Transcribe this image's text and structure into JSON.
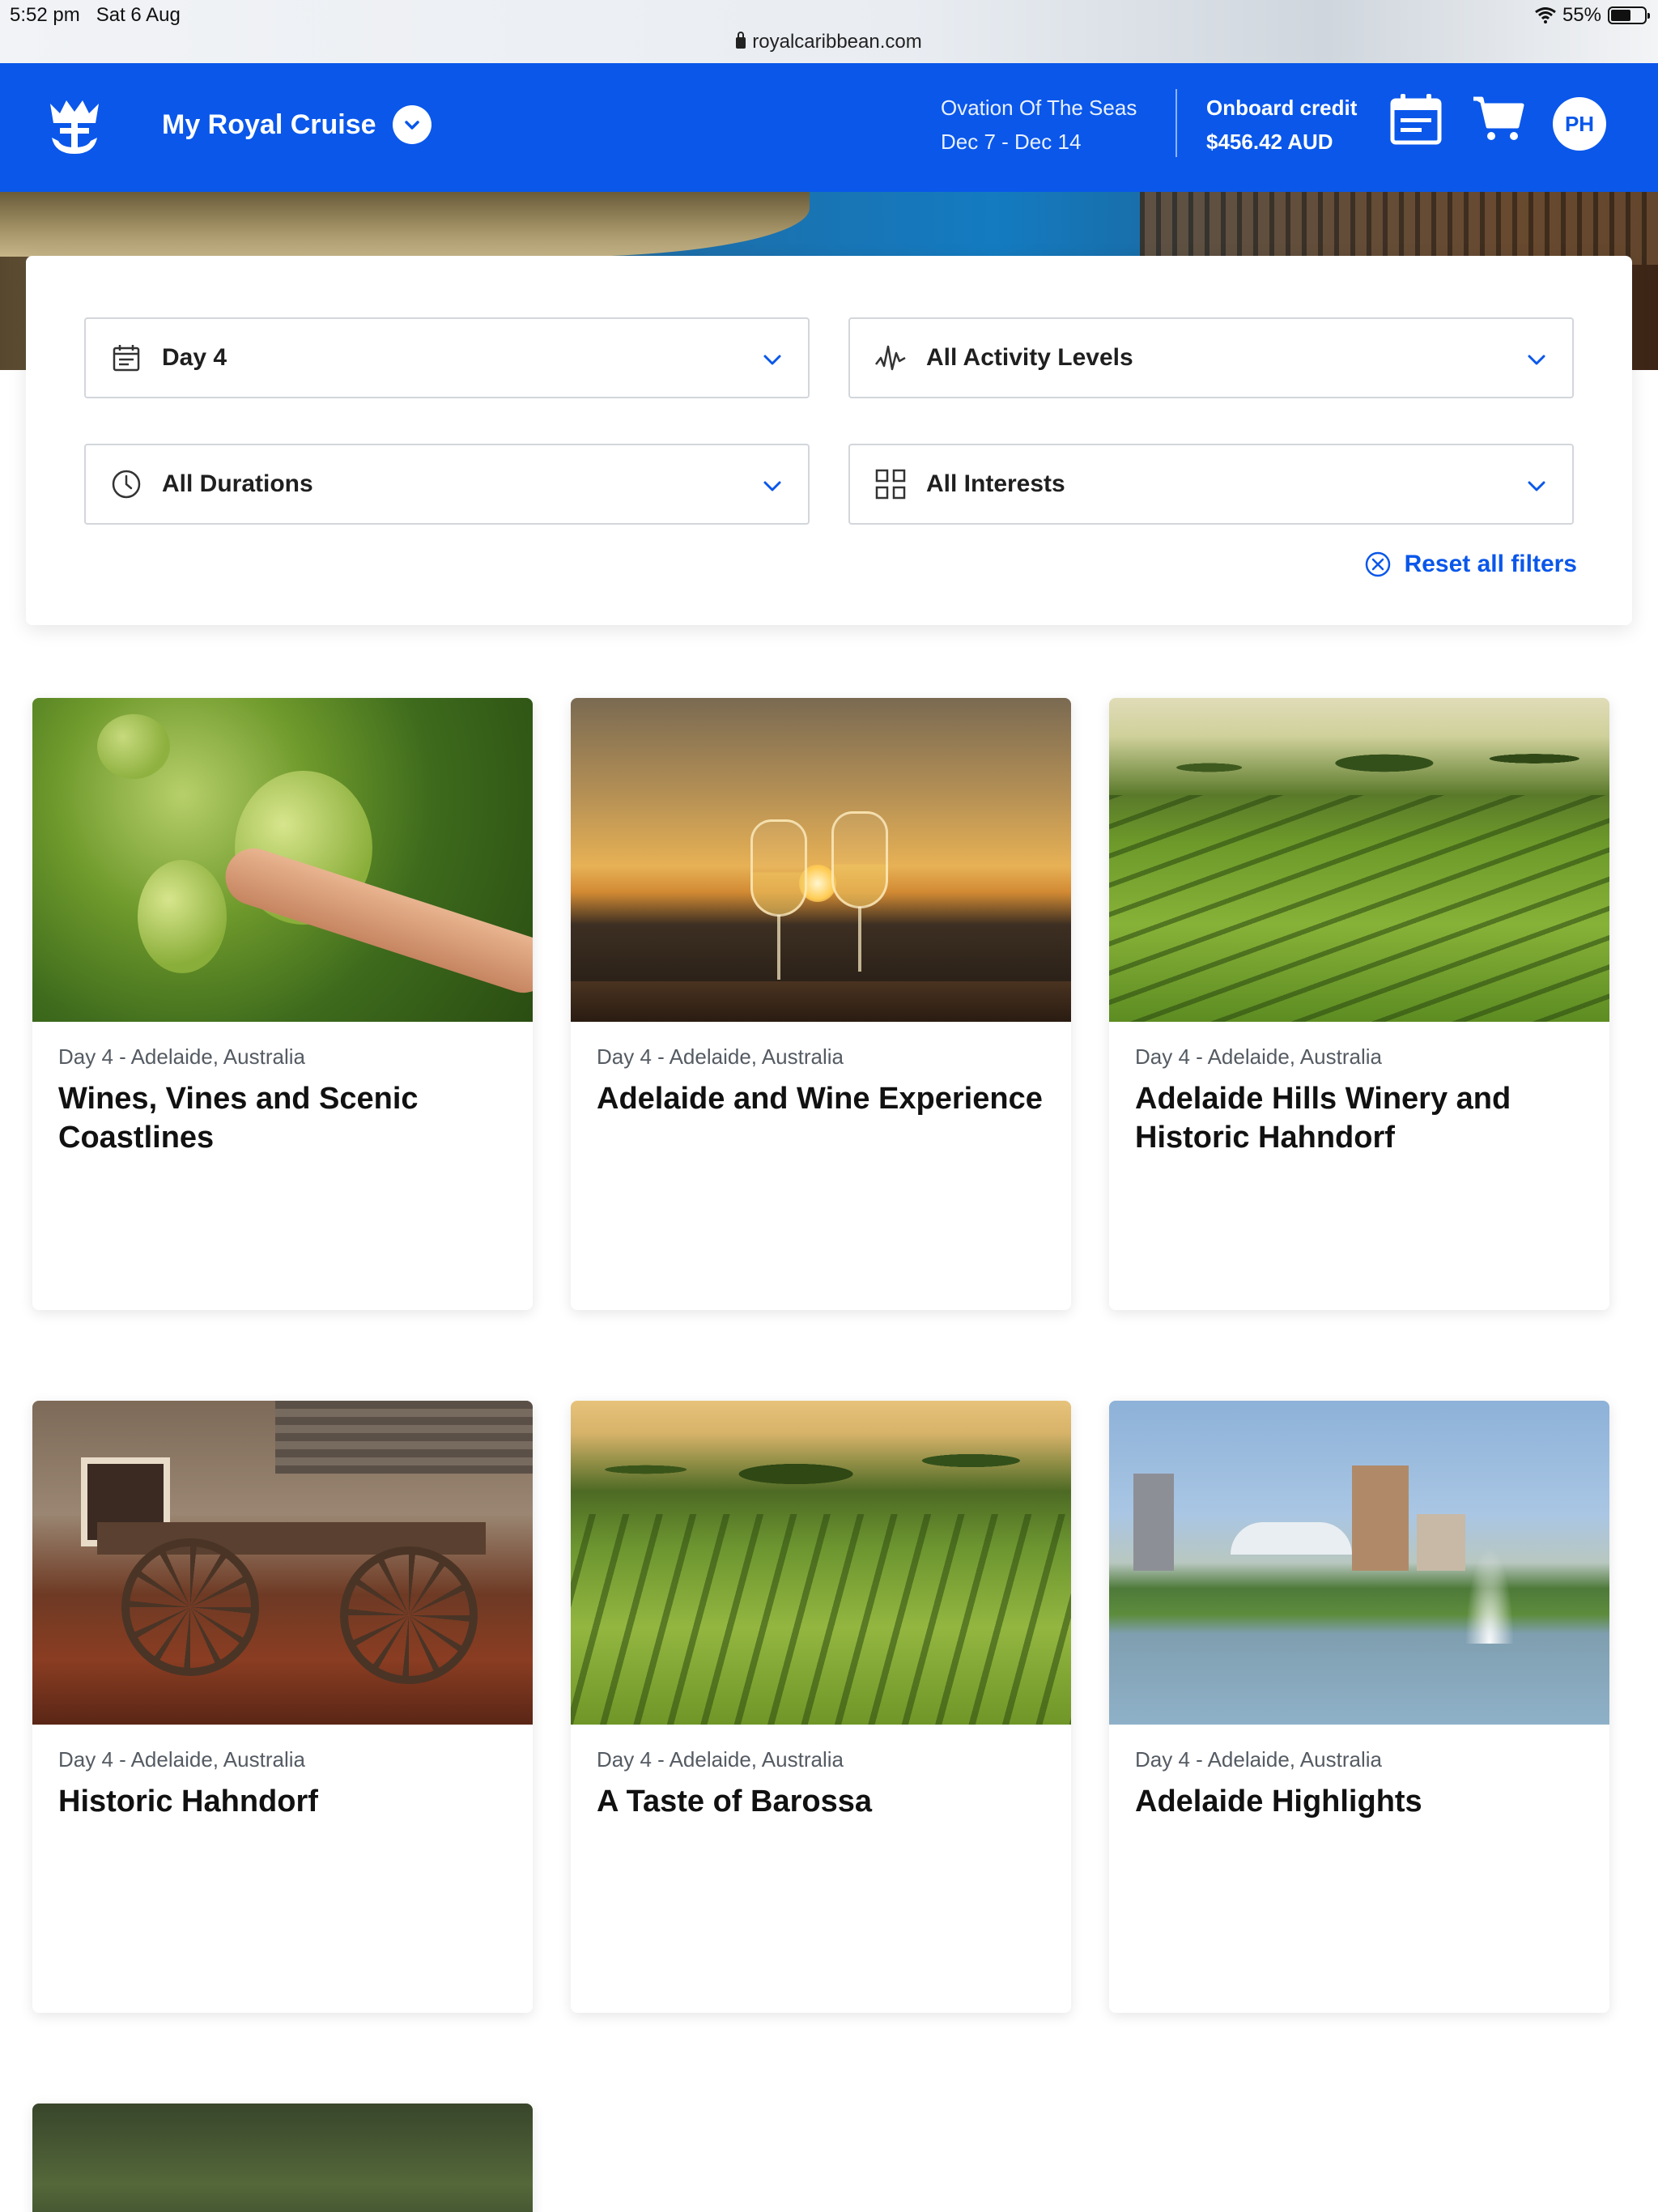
{
  "status_bar": {
    "time": "5:52 pm",
    "date": "Sat 6 Aug",
    "battery": "55%",
    "url": "royalcaribbean.com"
  },
  "header": {
    "title": "My Royal Cruise",
    "ship_name": "Ovation Of The Seas",
    "dates": "Dec 7 - Dec 14",
    "credit_label": "Onboard credit",
    "credit_value": "$456.42 AUD",
    "avatar_initials": "PH",
    "brand_color": "#0a57ea"
  },
  "filters": {
    "day": "Day 4",
    "activity": "All Activity Levels",
    "duration": "All Durations",
    "interests": "All Interests",
    "reset_label": "Reset all filters"
  },
  "cards": [
    {
      "meta": "Day 4 - Adelaide, Australia",
      "title": "Wines, Vines and Scenic Coastlines"
    },
    {
      "meta": "Day 4 - Adelaide, Australia",
      "title": "Adelaide and Wine Experience"
    },
    {
      "meta": "Day 4 - Adelaide, Australia",
      "title": "Adelaide Hills Winery and Historic Hahndorf"
    },
    {
      "meta": "Day 4 - Adelaide, Australia",
      "title": "Historic Hahndorf"
    },
    {
      "meta": "Day 4 - Adelaide, Australia",
      "title": "A Taste of Barossa"
    },
    {
      "meta": "Day 4 - Adelaide, Australia",
      "title": "Adelaide Highlights"
    }
  ]
}
